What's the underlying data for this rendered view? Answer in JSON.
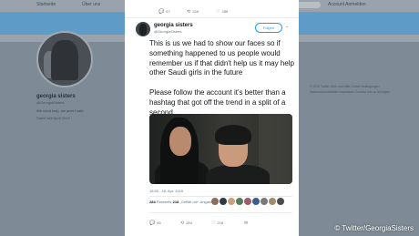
{
  "background": {
    "topbar": {
      "home": "Startseite",
      "about": "Über uns",
      "right": "Account   Anmelden"
    },
    "profile": {
      "name": "georgia sisters",
      "handle": "@GeorgiaSisters",
      "bio": "We need help, we aren't safe",
      "joined": "Dabei seit April 2019"
    },
    "footer_links": "© 2019 Twitter  Über uns  Hilfe-Center  Bedingungen  Datenschutzrichtlinie  Impressum  Cookies  Info zu Anzeigen"
  },
  "tweet": {
    "prev_actions": {
      "replies": "67",
      "retweets": "228",
      "likes": "288"
    },
    "author_name": "georgia sisters",
    "author_handle": "@GeorgiaSisters",
    "follow_label": "Folgen",
    "text": "This is us we had to show our faces so if something happened to us people would remember us if that didn't help us it may help other Saudi girls in the future\n\nPlease follow the account it's better than a hashtag that got off the trend in a split of a second",
    "timestamp": "18:50 - 18. Apr. 2019",
    "retweet_count": "284",
    "retweet_label": "Retweets",
    "like_count": "218",
    "like_label": "„Gefällt mir“-Angaben",
    "actions": {
      "replies": "65",
      "retweets": "284",
      "likes": "218"
    }
  },
  "credit": "© Twitter/GeorgiaSisters",
  "colors": {
    "accent": "#1da1f2",
    "banner": "#5e9bc6"
  }
}
